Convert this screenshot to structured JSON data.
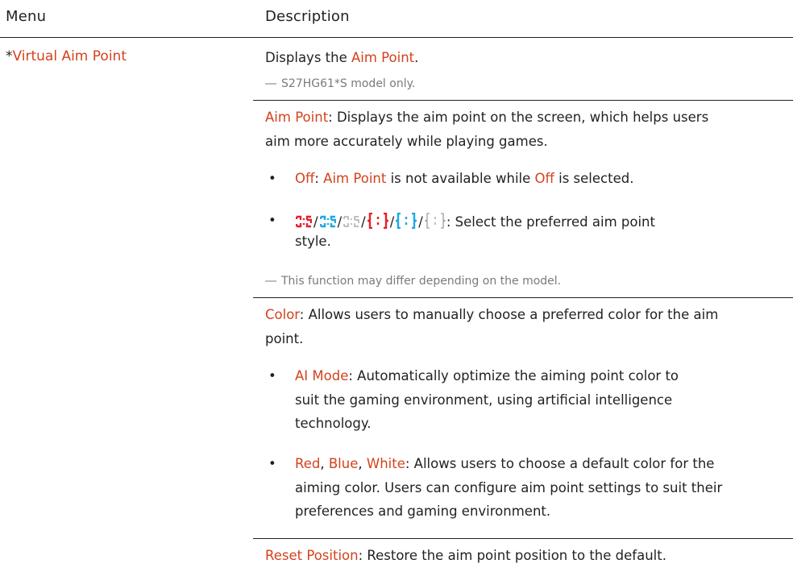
{
  "header": {
    "menu": "Menu",
    "description": "Description"
  },
  "row": {
    "menu_prefix": "*",
    "menu_label": "Virtual Aim Point"
  },
  "intro": {
    "pre": "Displays the ",
    "term": "Aim Point",
    "post": "."
  },
  "notes": {
    "model_only": "S27HG61*S model only.",
    "differ": "This function may differ depending on the model."
  },
  "aim_point": {
    "term": "Aim Point",
    "line1": ": Displays the aim point on the screen, which helps users",
    "line2": "aim more accurately while playing games.",
    "off_term": "Off",
    "off_sep": ": ",
    "off_term2": "Aim Point",
    "off_mid": " is not available while ",
    "off_term3": "Off",
    "off_post": " is selected.",
    "styles_text_line1": ": Select the preferred aim point",
    "styles_text_line2": "style.",
    "separator": "/"
  },
  "color": {
    "term": "Color",
    "line1": ": Allows users to manually choose a preferred color for the aim",
    "line2": "point.",
    "ai_term": "AI Mode",
    "ai_line1": ": Automatically optimize the aiming point color to",
    "ai_line2": "suit the gaming environment, using artificial intelligence",
    "ai_line3": "technology.",
    "red": "Red",
    "blue": "Blue",
    "white": "White",
    "comma": ", ",
    "rbw_line1": ": Allows users to choose a default color for the",
    "rbw_line2": "aiming color. Users can configure aim point settings to suit their",
    "rbw_line3": "preferences and gaming environment."
  },
  "reset": {
    "term": "Reset Position",
    "text": ": Restore the aim point position to the default."
  },
  "bullet_char": "•",
  "note_mark": "―",
  "colors": {
    "highlight": "#d3421d",
    "icon_red": "#e8202a",
    "icon_blue": "#1ea8e6",
    "icon_white": "#9a9a9a"
  },
  "icons": [
    "aim-style-1-red",
    "aim-style-1-blue",
    "aim-style-1-white",
    "aim-style-2-red",
    "aim-style-2-blue",
    "aim-style-2-white"
  ]
}
